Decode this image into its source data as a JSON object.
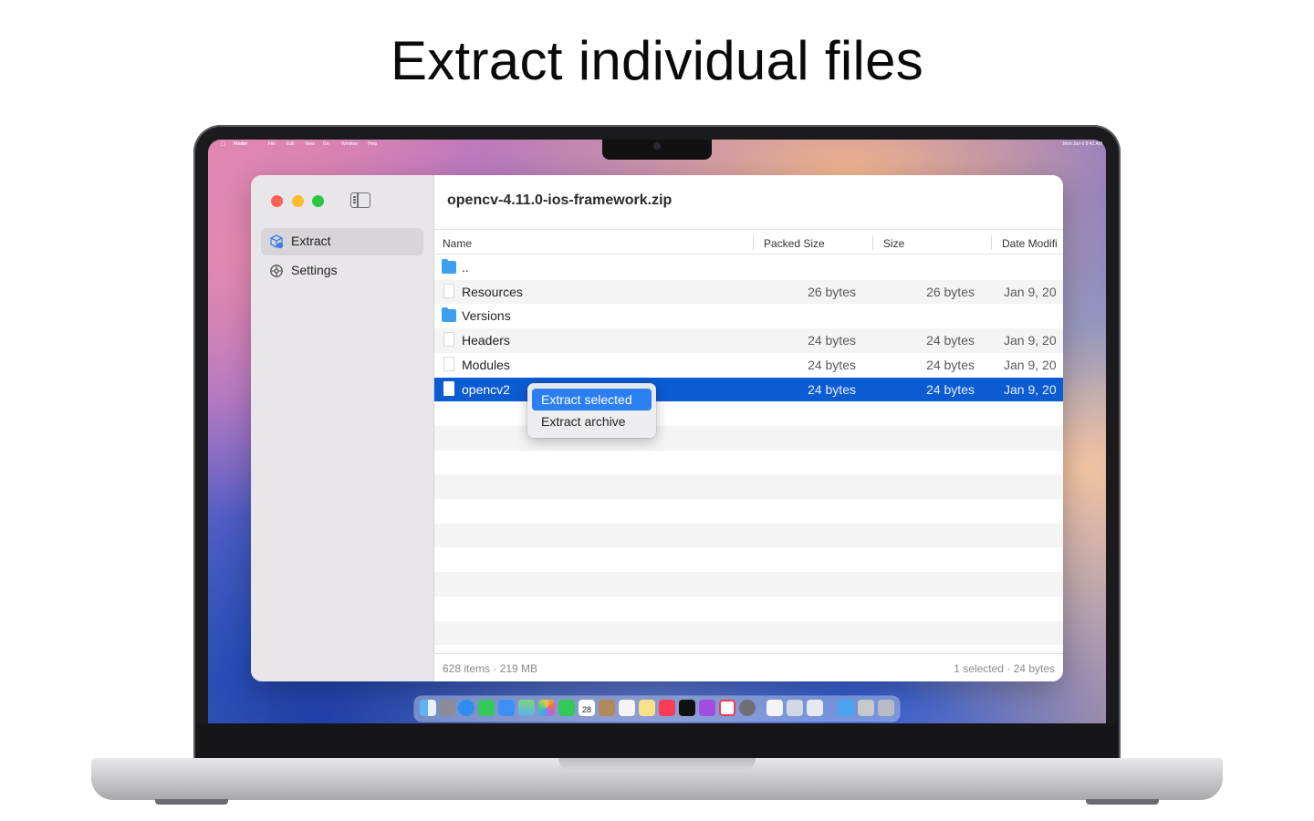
{
  "headline": "Extract individual files",
  "menubar": {
    "app": "Finder",
    "items": [
      "File",
      "Edit",
      "View",
      "Go",
      "Window",
      "Help"
    ],
    "clock": "Mon Jun 6  9:41 AM"
  },
  "sidebar": {
    "items": [
      {
        "label": "Extract",
        "icon": "extract-icon",
        "active": true
      },
      {
        "label": "Settings",
        "icon": "settings-icon",
        "active": false
      }
    ]
  },
  "window": {
    "title": "opencv-4.11.0-ios-framework.zip"
  },
  "columns": {
    "name": "Name",
    "packed": "Packed Size",
    "size": "Size",
    "date": "Date Modifi"
  },
  "rows": [
    {
      "name": "..",
      "type": "folder",
      "packed": "",
      "size": "",
      "date": ""
    },
    {
      "name": "Resources",
      "type": "file",
      "packed": "26 bytes",
      "size": "26 bytes",
      "date": "Jan 9, 20"
    },
    {
      "name": "Versions",
      "type": "folder",
      "packed": "",
      "size": "",
      "date": ""
    },
    {
      "name": "Headers",
      "type": "file",
      "packed": "24 bytes",
      "size": "24 bytes",
      "date": "Jan 9, 20"
    },
    {
      "name": "Modules",
      "type": "file",
      "packed": "24 bytes",
      "size": "24 bytes",
      "date": "Jan 9, 20"
    },
    {
      "name": "opencv2",
      "type": "file",
      "packed": "24 bytes",
      "size": "24 bytes",
      "date": "Jan 9, 20",
      "selected": true
    }
  ],
  "context_menu": {
    "items": [
      "Extract selected",
      "Extract archive"
    ],
    "highlighted": "Extract selected"
  },
  "status": {
    "left": "628 items · 219 MB",
    "right": "1 selected · 24 bytes"
  },
  "colors": {
    "selection": "#0b5bd3",
    "menu_highlight": "#2c7ff0",
    "folder": "#3aa0ef",
    "close": "#ff5f57",
    "minimize": "#febc2e",
    "zoom": "#28c840"
  },
  "dock": {
    "apps": [
      "finder-icon",
      "launchpad-icon",
      "safari-icon",
      "messages-icon",
      "mail-icon",
      "maps-icon",
      "photos-icon",
      "facetime-icon",
      "calendar-icon",
      "contacts-icon",
      "reminders-icon",
      "notes-icon",
      "music-icon",
      "tv-icon",
      "podcasts-icon",
      "news-icon",
      "settings-icon",
      "textedit-icon",
      "preview-icon",
      "app-icon",
      "folder-icon",
      "archive-icon",
      "trash-icon"
    ],
    "calendar_day": "28"
  }
}
